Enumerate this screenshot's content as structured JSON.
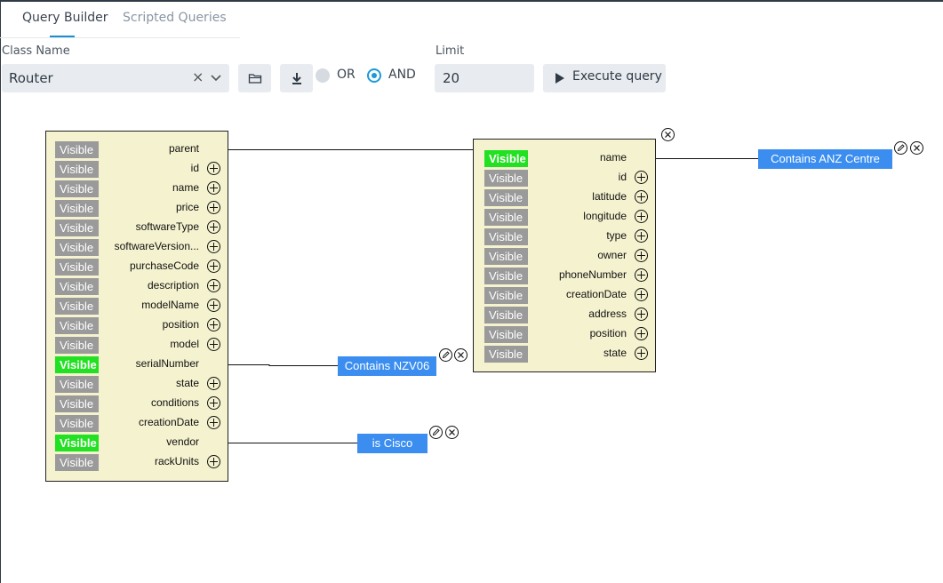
{
  "tabs": [
    {
      "label": "Query Builder"
    },
    {
      "label": "Scripted Queries"
    }
  ],
  "form": {
    "class_name_label": "Class Name",
    "class_name_value": "Router",
    "clear_glyph": "×",
    "or_label": "OR",
    "and_label": "AND",
    "selected_logic": "AND",
    "limit_label": "Limit",
    "limit_value": "20",
    "execute_label": "Execute query"
  },
  "icons": {
    "open": "folder-icon",
    "download": "download-icon",
    "execute": "play-icon",
    "add_field": "plus-circle-icon",
    "edit_filter": "pencil-icon",
    "remove": "close-circle-icon"
  },
  "colors": {
    "accent": "#1b9ad6",
    "visible_on": "#22e022",
    "visible_off": "#9a9a9a",
    "entity_bg": "#f5f2cf",
    "chip": "#3b8ef0"
  },
  "router": {
    "fields": [
      {
        "name": "parent",
        "visible": "Visible",
        "on": false,
        "plus": false
      },
      {
        "name": "id",
        "visible": "Visible",
        "on": false,
        "plus": true
      },
      {
        "name": "name",
        "visible": "Visible",
        "on": false,
        "plus": true
      },
      {
        "name": "price",
        "visible": "Visible",
        "on": false,
        "plus": true
      },
      {
        "name": "softwareType",
        "visible": "Visible",
        "on": false,
        "plus": true
      },
      {
        "name": "softwareVersion...",
        "visible": "Visible",
        "on": false,
        "plus": true
      },
      {
        "name": "purchaseCode",
        "visible": "Visible",
        "on": false,
        "plus": true
      },
      {
        "name": "description",
        "visible": "Visible",
        "on": false,
        "plus": true
      },
      {
        "name": "modelName",
        "visible": "Visible",
        "on": false,
        "plus": true
      },
      {
        "name": "position",
        "visible": "Visible",
        "on": false,
        "plus": true
      },
      {
        "name": "model",
        "visible": "Visible",
        "on": false,
        "plus": true
      },
      {
        "name": "serialNumber",
        "visible": "Visible",
        "on": true,
        "plus": false
      },
      {
        "name": "state",
        "visible": "Visible",
        "on": false,
        "plus": true
      },
      {
        "name": "conditions",
        "visible": "Visible",
        "on": false,
        "plus": true
      },
      {
        "name": "creationDate",
        "visible": "Visible",
        "on": false,
        "plus": true
      },
      {
        "name": "vendor",
        "visible": "Visible",
        "on": true,
        "plus": false
      },
      {
        "name": "rackUnits",
        "visible": "Visible",
        "on": false,
        "plus": true
      }
    ]
  },
  "parent_entity": {
    "fields": [
      {
        "name": "name",
        "visible": "Visible",
        "on": true,
        "plus": false
      },
      {
        "name": "id",
        "visible": "Visible",
        "on": false,
        "plus": true
      },
      {
        "name": "latitude",
        "visible": "Visible",
        "on": false,
        "plus": true
      },
      {
        "name": "longitude",
        "visible": "Visible",
        "on": false,
        "plus": true
      },
      {
        "name": "type",
        "visible": "Visible",
        "on": false,
        "plus": true
      },
      {
        "name": "owner",
        "visible": "Visible",
        "on": false,
        "plus": true
      },
      {
        "name": "phoneNumber",
        "visible": "Visible",
        "on": false,
        "plus": true
      },
      {
        "name": "creationDate",
        "visible": "Visible",
        "on": false,
        "plus": true
      },
      {
        "name": "address",
        "visible": "Visible",
        "on": false,
        "plus": true
      },
      {
        "name": "position",
        "visible": "Visible",
        "on": false,
        "plus": true
      },
      {
        "name": "state",
        "visible": "Visible",
        "on": false,
        "plus": true
      }
    ]
  },
  "filters": [
    {
      "label": "Contains ANZ Centre",
      "field": "name"
    },
    {
      "label": "Contains NZV06",
      "field": "serialNumber"
    },
    {
      "label": "is Cisco",
      "field": "vendor"
    }
  ]
}
